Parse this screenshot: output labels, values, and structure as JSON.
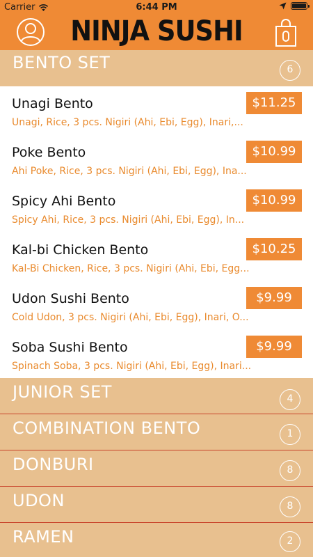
{
  "status": {
    "carrier": "Carrier",
    "time": "6:44 PM"
  },
  "app": {
    "title": "NINJA SUSHI"
  },
  "sections": [
    {
      "title": "BENTO SET",
      "count": "6"
    },
    {
      "title": "JUNIOR SET",
      "count": "4"
    },
    {
      "title": "COMBINATION BENTO",
      "count": "1"
    },
    {
      "title": "DONBURI",
      "count": "8"
    },
    {
      "title": "UDON",
      "count": "8"
    },
    {
      "title": "RAMEN",
      "count": "2"
    }
  ],
  "items": [
    {
      "name": "Unagi Bento",
      "price": "$11.25",
      "desc": "Unagi, Rice, 3 pcs. Nigiri (Ahi, Ebi, Egg), Inari,..."
    },
    {
      "name": "Poke Bento",
      "price": "$10.99",
      "desc": "Ahi Poke, Rice, 3 pcs. Nigiri (Ahi, Ebi, Egg), Ina..."
    },
    {
      "name": "Spicy Ahi Bento",
      "price": "$10.99",
      "desc": "Spicy Ahi, Rice, 3 pcs. Nigiri (Ahi, Ebi, Egg), In..."
    },
    {
      "name": "Kal-bi Chicken Bento",
      "price": "$10.25",
      "desc": "Kal-Bi Chicken, Rice, 3 pcs. Nigiri (Ahi, Ebi, Egg..."
    },
    {
      "name": "Udon Sushi Bento",
      "price": "$9.99",
      "desc": "Cold Udon, 3 pcs. Nigiri (Ahi, Ebi, Egg), Inari, O..."
    },
    {
      "name": "Soba Sushi Bento",
      "price": "$9.99",
      "desc": "Spinach Soba, 3 pcs. Nigiri (Ahi, Ebi, Egg), Inari..."
    }
  ],
  "icons": {
    "profile": "profile-icon",
    "cart": "shopping-bag-icon",
    "wifi": "wifi-icon",
    "location": "location-arrow-icon",
    "battery": "battery-icon"
  },
  "colors": {
    "accent": "#ef8a35",
    "section_bg": "#e8c08f",
    "description": "#e98a2d"
  }
}
